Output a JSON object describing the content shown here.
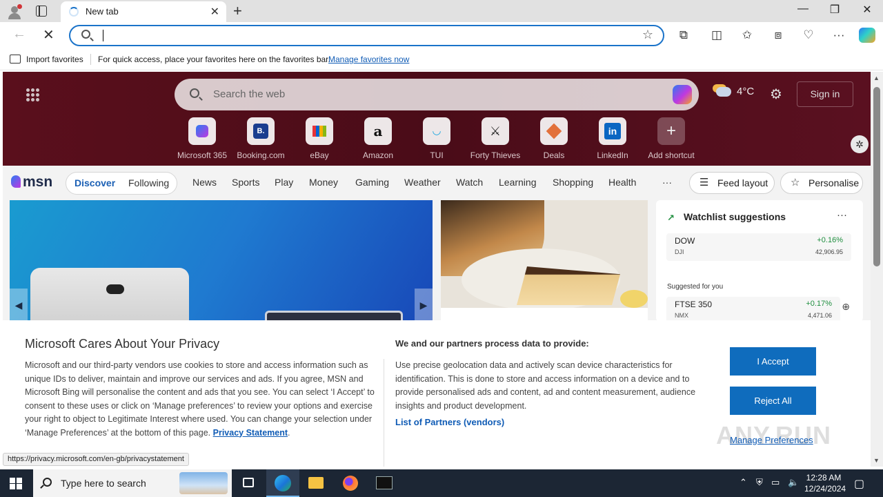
{
  "browser": {
    "tab_title": "New tab",
    "address_value": "",
    "favorites_bar": {
      "import_label": "Import favorites",
      "message": "For quick access, place your favorites here on the favorites bar.",
      "manage_link": "Manage favorites now"
    },
    "status_url": "https://privacy.microsoft.com/en-gb/privacystatement"
  },
  "msn": {
    "search_placeholder": "Search the web",
    "weather": "4°C",
    "sign_in": "Sign in",
    "shortcuts": [
      {
        "label": "Microsoft 365",
        "icon": "microsoft-365-icon"
      },
      {
        "label": "Booking.com",
        "icon": "booking-icon"
      },
      {
        "label": "eBay",
        "icon": "ebay-icon"
      },
      {
        "label": "Amazon",
        "icon": "amazon-icon"
      },
      {
        "label": "TUI",
        "icon": "tui-icon"
      },
      {
        "label": "Forty Thieves",
        "icon": "forty-thieves-icon"
      },
      {
        "label": "Deals",
        "icon": "deals-icon"
      },
      {
        "label": "LinkedIn",
        "icon": "linkedin-icon"
      },
      {
        "label": "Add shortcut",
        "icon": "plus-icon"
      }
    ],
    "logo": "msn",
    "tabs": {
      "discover": "Discover",
      "following": "Following"
    },
    "nav": [
      "News",
      "Sports",
      "Play",
      "Money",
      "Gaming",
      "Weather",
      "Watch",
      "Learning",
      "Shopping",
      "Health"
    ],
    "more": "···",
    "feed_layout": "Feed layout",
    "personalise": "Personalise",
    "watchlist": {
      "title": "Watchlist suggestions",
      "more": "···",
      "items": [
        {
          "symbol": "DOW",
          "sub": "DJI",
          "change": "+0.16%",
          "value": "42,906.95"
        }
      ],
      "suggested_label": "Suggested for you",
      "suggested": [
        {
          "symbol": "FTSE 350",
          "sub": "NMX",
          "change": "+0.17%",
          "value": "4,471.06"
        }
      ]
    }
  },
  "privacy": {
    "title": "Microsoft Cares About Your Privacy",
    "body": "Microsoft and our third-party vendors use cookies to store and access information such as unique IDs to deliver, maintain and improve our services and ads. If you agree, MSN and Microsoft Bing will personalise the content and ads that you see. You can select ‘I Accept’ to consent to these uses or click on ‘Manage preferences’ to review your options and exercise your right to object to Legitimate Interest where used.  You can change your selection under ‘Manage Preferences’ at the bottom of this page.",
    "privacy_link": "Privacy Statement",
    "right_title": "We and our partners process data to provide:",
    "right_body": "Use precise geolocation data and actively scan device characteristics for identification. This is done to store and access information on a device and to provide personalised ads and content, ad and content measurement, audience insights and product development.",
    "partners_link": "List of Partners (vendors)",
    "accept": "I Accept",
    "reject": "Reject All",
    "manage": "Manage Preferences"
  },
  "watermark": "ANY.RUN",
  "taskbar": {
    "search_placeholder": "Type here to search",
    "time": "12:28 AM",
    "date": "12/24/2024"
  },
  "colors": {
    "accent": "#0f6cbd",
    "hero_bg": "#4a0c18",
    "taskbar": "#1c2634"
  }
}
